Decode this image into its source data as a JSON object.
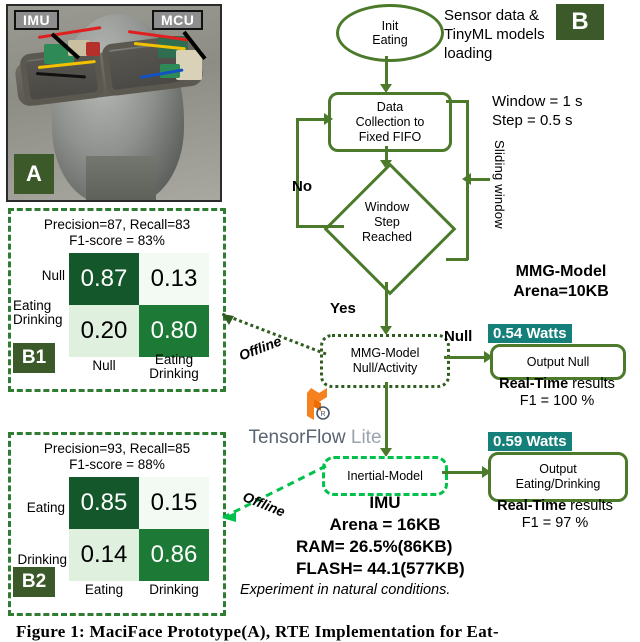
{
  "panel_a": {
    "badge": "A",
    "labels": [
      {
        "name": "imu-callout",
        "text": "IMU"
      },
      {
        "name": "mcu-callout",
        "text": "MCU"
      }
    ]
  },
  "panel_b": {
    "badge": "B"
  },
  "matrices": [
    {
      "badge": "B1",
      "title_line1": "Precision=87, Recall=83",
      "title_line2": "F1-score = 83%",
      "row_labels": [
        "Null",
        "Eating\nDrinking"
      ],
      "col_labels": [
        "Null",
        "Eating\nDrinking"
      ],
      "values": [
        [
          "0.87",
          "0.13"
        ],
        [
          "0.20",
          "0.80"
        ]
      ]
    },
    {
      "badge": "B2",
      "title_line1": "Precision=93, Recall=85",
      "title_line2": "F1-score = 88%",
      "row_labels": [
        "Eating",
        "Drinking"
      ],
      "col_labels": [
        "Eating",
        "Drinking"
      ],
      "values": [
        [
          "0.85",
          "0.15"
        ],
        [
          "0.14",
          "0.86"
        ]
      ]
    }
  ],
  "flow": {
    "init": "Init\nEating",
    "init_l1": "Init",
    "init_l2": "Eating",
    "data_collection_l1": "Data",
    "data_collection_l2": "Collection to",
    "data_collection_l3": "Fixed FIFO",
    "decision_l1": "Window",
    "decision_l2": "Step",
    "decision_l3": "Reached",
    "branch_no": "No",
    "branch_yes": "Yes",
    "sliding_window": "Sliding window",
    "mmg_model_l1": "MMG-Model",
    "mmg_model_l2": "Null/Activity",
    "inertial_model": "Inertial-Model",
    "output_null": "Output Null",
    "output_eating_l1": "Output",
    "output_eating_l2": "Eating/Drinking",
    "null_edge_label": "Null",
    "offline_1": "Offline",
    "offline_2": "Offline"
  },
  "annotations": {
    "sensor_note_l1": "Sensor data  &",
    "sensor_note_l2": "TinyML models",
    "sensor_note_l3": "loading",
    "window_note_l1": "Window  = 1 s",
    "window_note_l2": "Step = 0.5 s",
    "mmg_arena_l1": "MMG-Model",
    "mmg_arena_l2": "Arena=10KB",
    "watts_mmg": "0.54 Watts",
    "watts_imu": "0.59 Watts",
    "rt_results_bold": "Real-Time",
    "rt_results_rest": " results",
    "f1_mmg": "F1 =  100 %",
    "f1_imu": "F1 =  97 %",
    "imu_title": "IMU",
    "imu_arena": "Arena = 16KB",
    "ram": "RAM= 26.5%(86KB)",
    "flash": "FLASH= 44.1(577KB)",
    "experiment_note": "Experiment in natural conditions."
  },
  "logo": {
    "name": "TensorFlow",
    "lite": " Lite"
  },
  "caption": "Figure 1: MaciFace Prototype(A), RTE Implementation for Eat-",
  "colors": {
    "flow_green": "#4b7a2b",
    "dashed_green": "#00c24a",
    "dark_badge": "#3c5a29",
    "matrix_dark": "#14572a",
    "matrix_light": "#f3faf3",
    "teal_badge": "#157f79",
    "tf_orange": "#f5821f"
  }
}
